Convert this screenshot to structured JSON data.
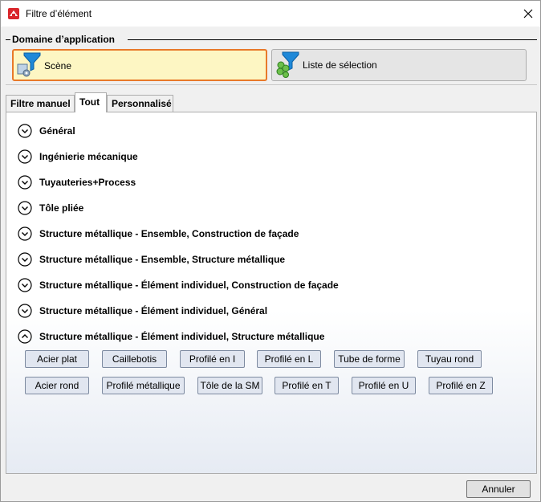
{
  "window": {
    "title": "Filtre d’élément"
  },
  "domain": {
    "label": "Domaine d’application",
    "scene_label": "Scène",
    "list_label": "Liste de sélection"
  },
  "tabs": [
    {
      "label": "Filtre manuel",
      "active": false
    },
    {
      "label": "Tout",
      "active": true
    },
    {
      "label": "Personnalisé",
      "active": false
    }
  ],
  "sections": [
    {
      "label": "Général",
      "expanded": false
    },
    {
      "label": "Ingénierie mécanique",
      "expanded": false
    },
    {
      "label": "Tuyauteries+Process",
      "expanded": false
    },
    {
      "label": "Tôle pliée",
      "expanded": false
    },
    {
      "label": "Structure métallique - Ensemble, Construction de façade",
      "expanded": false
    },
    {
      "label": "Structure métallique - Ensemble, Structure métallique",
      "expanded": false
    },
    {
      "label": "Structure métallique - Élément individuel, Construction de façade",
      "expanded": false
    },
    {
      "label": "Structure métallique - Élément individuel, Général",
      "expanded": false
    },
    {
      "label": "Structure métallique - Élément individuel, Structure métallique",
      "expanded": true
    }
  ],
  "chips_row1": [
    "Acier plat",
    "Caillebotis",
    "Profilé en I",
    "Profilé en L",
    "Tube de forme",
    "Tuyau rond"
  ],
  "chips_row2": [
    "Acier rond",
    "Profilé métallique",
    "Tôle de la SM",
    "Profilé en T",
    "Profilé en U",
    "Profilé en Z"
  ],
  "footer": {
    "cancel_label": "Annuler"
  },
  "colors": {
    "accent_orange": "#e8792a",
    "scene_bg": "#fdf6c3",
    "chip_bg": "#e1e6f0"
  }
}
